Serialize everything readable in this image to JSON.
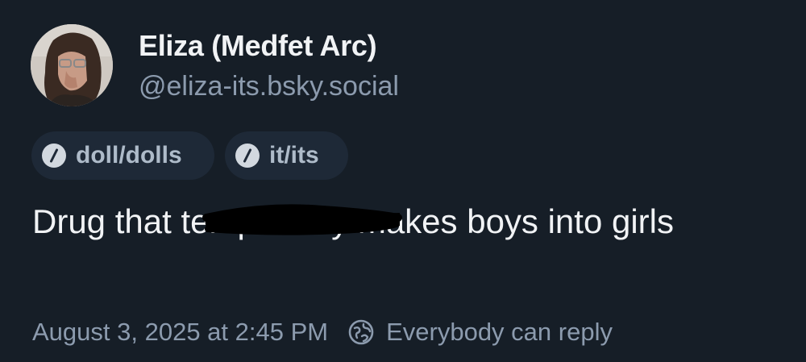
{
  "author": {
    "display_name": "Eliza (Medfet Arc)",
    "handle": "@eliza-its.bsky.social",
    "avatar_icon": "profile-photo"
  },
  "pronoun_tags": [
    {
      "label": "doll/dolls",
      "icon": "slash-circle-icon"
    },
    {
      "label": "it/its",
      "icon": "slash-circle-icon"
    }
  ],
  "post": {
    "text_before": "Drug that ",
    "text_censored": "temporarily",
    "text_after": " makes boys into girls"
  },
  "meta": {
    "timestamp": "August 3, 2025 at 2:45 PM",
    "reply_setting": "Everybody can reply",
    "reply_icon": "globe-reply-icon"
  },
  "colors": {
    "background": "#161e27",
    "text_primary": "#f1f3f5",
    "text_secondary": "#8c9bae",
    "pill_background": "#1e2937",
    "pill_text": "#aebbc9",
    "redaction": "#000000"
  }
}
